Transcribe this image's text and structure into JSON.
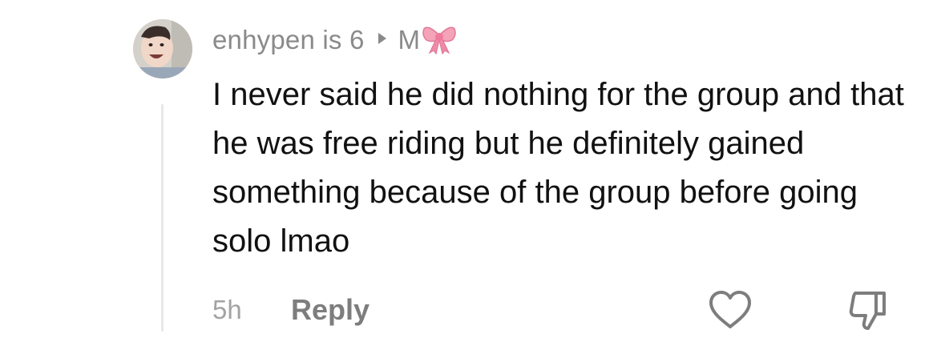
{
  "comment": {
    "username": "enhypen is 6",
    "reply_to": "M",
    "text": "I never said he did nothing for the group and that he was free riding but he definitely gained something because of the group before going solo lmao",
    "timestamp": "5h",
    "reply_label": "Reply",
    "icons": {
      "caret": "caret-right-icon",
      "bow": "ribbon-bow-emoji",
      "like": "heart-outline-icon",
      "dislike": "thumbs-down-outline-icon"
    },
    "colors": {
      "meta_text": "#8a8a8a",
      "body_text": "#111111",
      "bow_pink": "#f4a3b8"
    }
  }
}
